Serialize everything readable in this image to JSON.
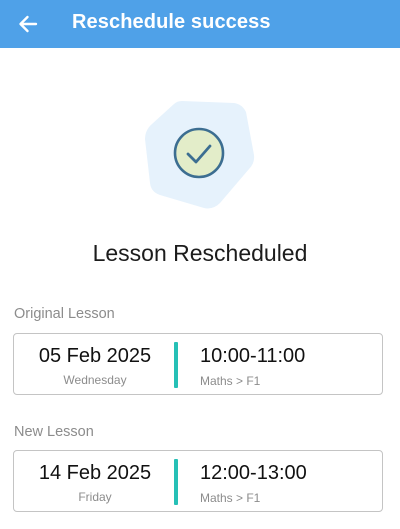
{
  "appbar": {
    "title": "Reschedule success",
    "back_icon": "arrow-left-icon"
  },
  "status": {
    "icon": "check-circle-icon",
    "headline": "Lesson Rescheduled"
  },
  "original": {
    "section_label": "Original Lesson",
    "date": "05 Feb 2025",
    "weekday": "Wednesday",
    "time": "10:00-11:00",
    "subject": "Maths > F1"
  },
  "new": {
    "section_label": "New Lesson",
    "date": "14 Feb 2025",
    "weekday": "Friday",
    "time": "12:00-13:00",
    "subject": "Maths > F1"
  },
  "colors": {
    "appbar": "#4fa1e8",
    "accent_divider": "#26c0b6",
    "illustration_bg": "#e6f2fc",
    "check_circle_fill": "#e3edc9",
    "check_stroke": "#3c6e91"
  }
}
